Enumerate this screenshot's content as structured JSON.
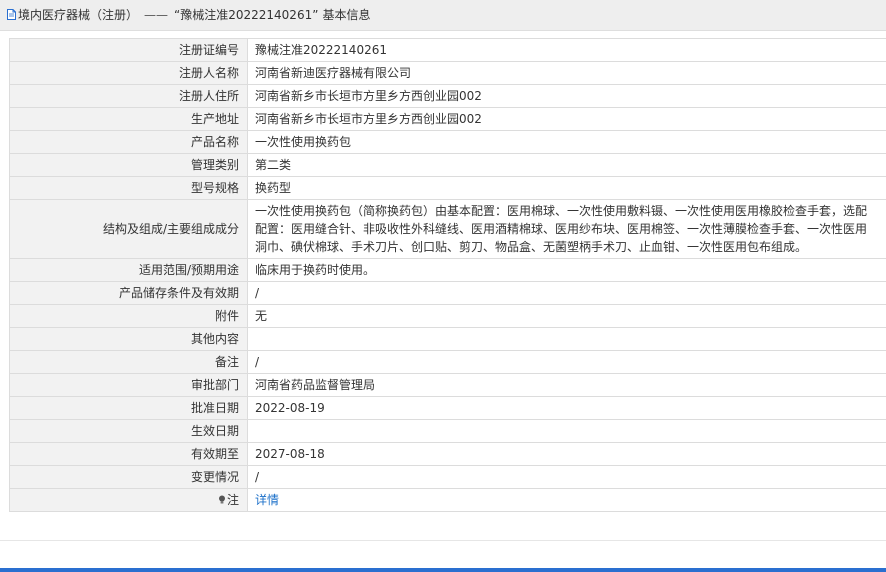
{
  "header": {
    "category": "境内医疗器械（注册）",
    "separator": "——",
    "registration_quoted": "“豫械注准20222140261”",
    "section": "基本信息"
  },
  "rows": [
    {
      "label": "注册证编号",
      "value": "豫械注准20222140261"
    },
    {
      "label": "注册人名称",
      "value": "河南省新迪医疗器械有限公司"
    },
    {
      "label": "注册人住所",
      "value": "河南省新乡市长垣市方里乡方西创业园002"
    },
    {
      "label": "生产地址",
      "value": "河南省新乡市长垣市方里乡方西创业园002"
    },
    {
      "label": "产品名称",
      "value": "一次性使用换药包"
    },
    {
      "label": "管理类别",
      "value": "第二类"
    },
    {
      "label": "型号规格",
      "value": "换药型"
    },
    {
      "label": "结构及组成/主要组成成分",
      "value": "一次性使用换药包（简称换药包）由基本配置：医用棉球、一次性使用敷料镊、一次性使用医用橡胶检查手套，选配配置：医用缝合针、非吸收性外科缝线、医用酒精棉球、医用纱布块、医用棉签、一次性薄膜检查手套、一次性医用洞巾、碘伏棉球、手术刀片、创口贴、剪刀、物品盒、无菌塑柄手术刀、止血钳、一次性医用包布组成。"
    },
    {
      "label": "适用范围/预期用途",
      "value": "临床用于换药时使用。"
    },
    {
      "label": "产品储存条件及有效期",
      "value": "/"
    },
    {
      "label": "附件",
      "value": "无"
    },
    {
      "label": "其他内容",
      "value": ""
    },
    {
      "label": "备注",
      "value": "/"
    },
    {
      "label": "审批部门",
      "value": "河南省药品监督管理局"
    },
    {
      "label": "批准日期",
      "value": "2022-08-19"
    },
    {
      "label": "生效日期",
      "value": ""
    },
    {
      "label": "有效期至",
      "value": "2027-08-18"
    },
    {
      "label": "变更情况",
      "value": "/"
    },
    {
      "label": "注",
      "value": "详情"
    }
  ],
  "icons": {
    "doc": "document-icon",
    "note": "lightbulb-icon"
  },
  "colors": {
    "link": "#1a6fc9",
    "label_bg": "#f2f2f2",
    "border": "#dcdcdc",
    "accent_bar": "#2a6fd0"
  }
}
